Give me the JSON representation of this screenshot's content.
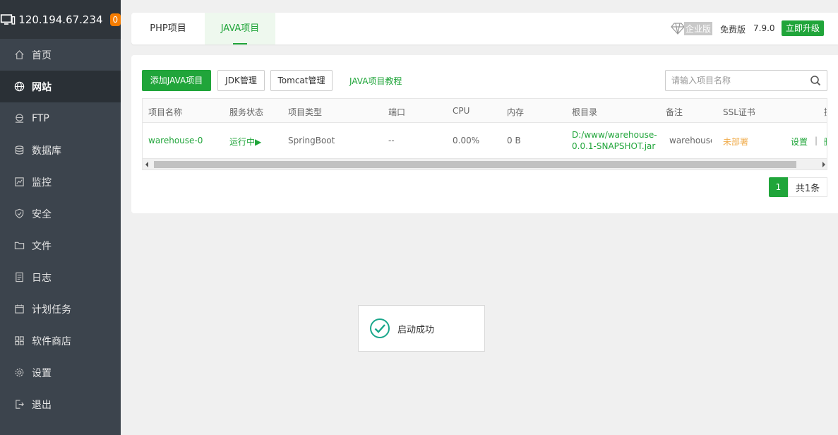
{
  "sidebar": {
    "server_ip": "120.194.67.234",
    "badge_count": "0",
    "items": [
      {
        "label": "首页",
        "icon": "home-icon"
      },
      {
        "label": "网站",
        "icon": "globe-icon"
      },
      {
        "label": "FTP",
        "icon": "ftp-icon"
      },
      {
        "label": "数据库",
        "icon": "database-icon"
      },
      {
        "label": "监控",
        "icon": "monitor-icon"
      },
      {
        "label": "安全",
        "icon": "shield-icon"
      },
      {
        "label": "文件",
        "icon": "folder-icon"
      },
      {
        "label": "日志",
        "icon": "log-icon"
      },
      {
        "label": "计划任务",
        "icon": "calendar-icon"
      },
      {
        "label": "软件商店",
        "icon": "apps-icon"
      },
      {
        "label": "设置",
        "icon": "gear-icon"
      },
      {
        "label": "退出",
        "icon": "logout-icon"
      }
    ]
  },
  "topbar": {
    "tabs": [
      "PHP项目",
      "JAVA项目"
    ],
    "enterprise_label": "企业版",
    "free_label": "免费版",
    "version": "7.9.0",
    "upgrade_label": "立即升级"
  },
  "toolbar": {
    "add_label": "添加JAVA项目",
    "jdk_label": "JDK管理",
    "tomcat_label": "Tomcat管理",
    "tutorial_label": "JAVA项目教程",
    "search_placeholder": "请输入项目名称"
  },
  "table": {
    "headers": [
      "项目名称",
      "服务状态",
      "项目类型",
      "端口",
      "CPU",
      "内存",
      "根目录",
      "备注",
      "SSL证书",
      "操"
    ],
    "rows": [
      {
        "name": "warehouse-0",
        "status": "运行中▶",
        "type": "SpringBoot",
        "port": "--",
        "cpu": "0.00%",
        "memory": "0 B",
        "root": "D:/www/warehouse-0.0.1-SNAPSHOT.jar",
        "note": "warehouse",
        "ssl": "未部署",
        "action_settings": "设置",
        "action_sep": "|",
        "action_more": "删"
      }
    ]
  },
  "pager": {
    "current": "1",
    "total": "共1条"
  },
  "toast": {
    "message": "启动成功"
  },
  "colors": {
    "accent": "#20a53a",
    "sidebar_bg": "#3c444d",
    "warning": "#f0ad4e"
  }
}
